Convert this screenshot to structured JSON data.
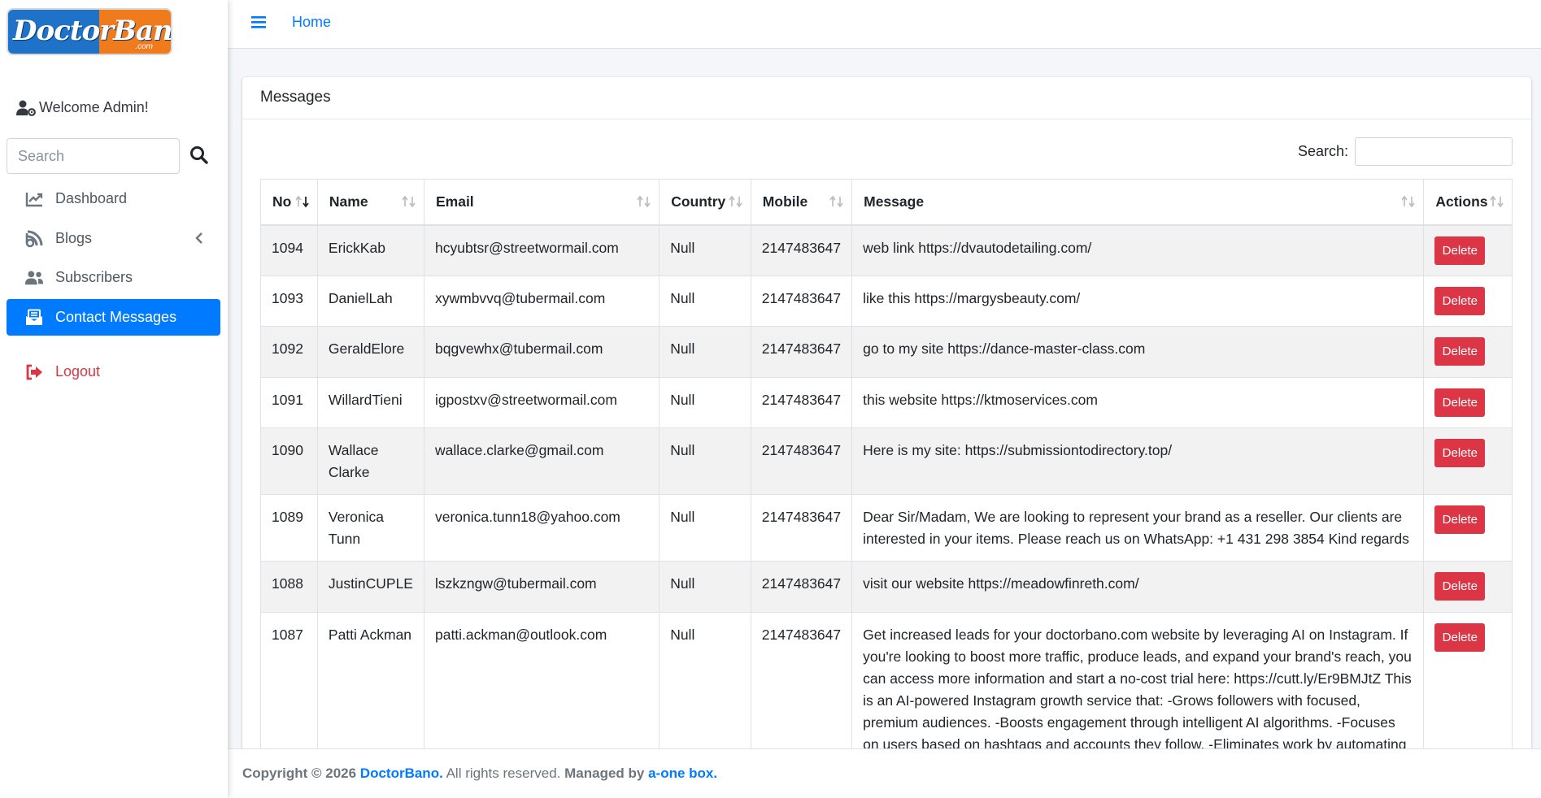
{
  "logo": {
    "text": "DoctorBano",
    "sub": ".com"
  },
  "sidebar": {
    "welcome": "Welcome Admin!",
    "search_placeholder": "Search",
    "items": [
      {
        "label": "Dashboard",
        "icon": "chart-line-icon"
      },
      {
        "label": "Blogs",
        "icon": "blog-icon"
      },
      {
        "label": "Subscribers",
        "icon": "users-icon"
      },
      {
        "label": "Contact Messages",
        "icon": "envelope-open-icon"
      },
      {
        "label": "Logout",
        "icon": "sign-out-icon"
      }
    ]
  },
  "topbar": {
    "home": "Home"
  },
  "card": {
    "title": "Messages",
    "search_label": "Search:",
    "columns": [
      "No",
      "Name",
      "Email",
      "Country",
      "Mobile",
      "Message",
      "Actions"
    ],
    "delete_label": "Delete",
    "rows": [
      {
        "no": "1094",
        "name": "ErickKab",
        "email": "hcyubtsr@streetwormail.com",
        "country": "Null",
        "mobile": "2147483647",
        "message": "web link https://dvautodetailing.com/"
      },
      {
        "no": "1093",
        "name": "DanielLah",
        "email": "xywmbvvq@tubermail.com",
        "country": "Null",
        "mobile": "2147483647",
        "message": "like this https://margysbeauty.com/"
      },
      {
        "no": "1092",
        "name": "GeraldElore",
        "email": "bqgvewhx@tubermail.com",
        "country": "Null",
        "mobile": "2147483647",
        "message": "go to my site https://dance-master-class.com"
      },
      {
        "no": "1091",
        "name": "WillardTieni",
        "email": "igpostxv@streetwormail.com",
        "country": "Null",
        "mobile": "2147483647",
        "message": "this website https://ktmoservices.com"
      },
      {
        "no": "1090",
        "name": "Wallace Clarke",
        "email": "wallace.clarke@gmail.com",
        "country": "Null",
        "mobile": "2147483647",
        "message": "Here is my site: https://submissiontodirectory.top/"
      },
      {
        "no": "1089",
        "name": "Veronica Tunn",
        "email": "veronica.tunn18@yahoo.com",
        "country": "Null",
        "mobile": "2147483647",
        "message": "Dear Sir/Madam, We are looking to represent your brand as a reseller. Our clients are interested in your items. Please reach us on WhatsApp: +1 431 298 3854 Kind regards"
      },
      {
        "no": "1088",
        "name": "JustinCUPLE",
        "email": "lszkzngw@tubermail.com",
        "country": "Null",
        "mobile": "2147483647",
        "message": "visit our website https://meadowfinreth.com/"
      },
      {
        "no": "1087",
        "name": "Patti Ackman",
        "email": "patti.ackman@outlook.com",
        "country": "Null",
        "mobile": "2147483647",
        "message": "Get increased leads for your doctorbano.com website by leveraging AI on Instagram. If you're looking to boost more traffic, produce leads, and expand your brand's reach, you can access more information and start a no-cost trial here: https://cutt.ly/Er9BMJtZ This is an AI-powered Instagram growth service that: -Grows followers with focused, premium audiences. -Boosts engagement through intelligent AI algorithms. -Focuses on users based on hashtags and accounts they follow. -Eliminates work by automating tedious Instagram"
      }
    ]
  },
  "footer": {
    "copyright": "Copyright © 2026",
    "brand": "DoctorBano.",
    "rights": "All rights reserved.",
    "managed": "Managed by",
    "manager": "a-one box."
  },
  "colors": {
    "primary": "#007bff",
    "danger": "#dc3545",
    "logo_blue": "#1e73c8",
    "logo_orange": "#f07b1d"
  }
}
